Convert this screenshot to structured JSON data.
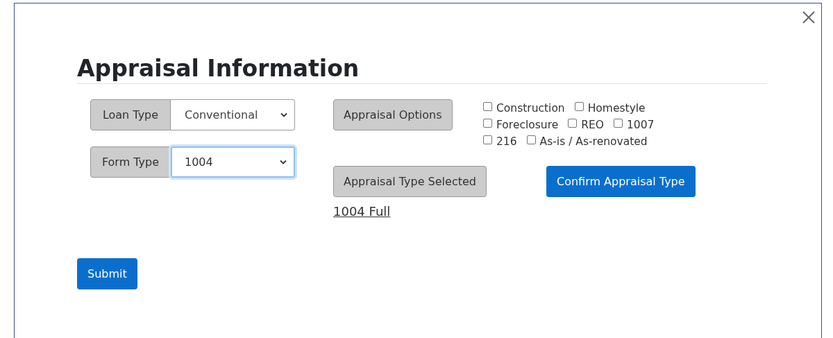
{
  "dialog": {
    "title": "Appraisal Information"
  },
  "fields": [
    {
      "label": "Loan Type",
      "value": "Conventional",
      "focused": false
    },
    {
      "label": "Form Type",
      "value": "1004",
      "focused": true
    }
  ],
  "appraisal_options": {
    "label": "Appraisal Options",
    "options": [
      [
        {
          "label": "Construction",
          "checked": false
        },
        {
          "label": "Homestyle",
          "checked": false
        }
      ],
      [
        {
          "label": "Foreclosure",
          "checked": false
        },
        {
          "label": "REO",
          "checked": false
        },
        {
          "label": "1007",
          "checked": false
        }
      ],
      [
        {
          "label": "216",
          "checked": false
        },
        {
          "label": "As-is / As-renovated",
          "checked": false
        }
      ]
    ]
  },
  "appraisal_type_selected": {
    "label": "Appraisal Type Selected",
    "value": "1004 Full"
  },
  "confirm_button": "Confirm Appraisal Type",
  "submit_button": "Submit"
}
